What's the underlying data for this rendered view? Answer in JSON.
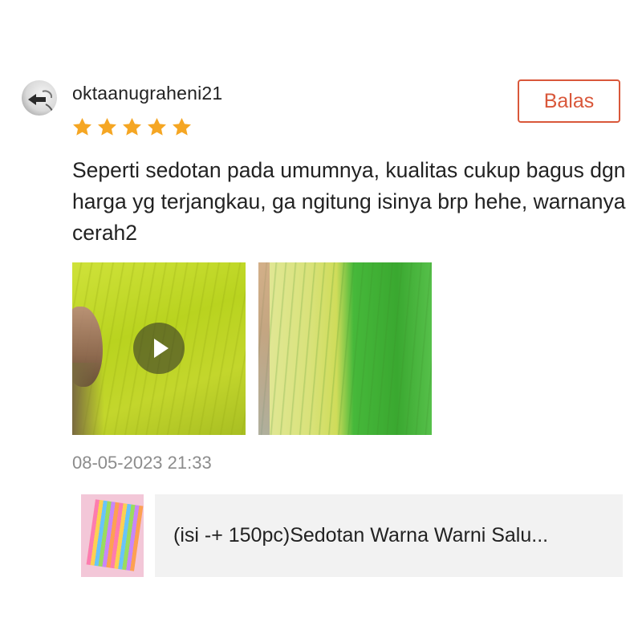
{
  "review": {
    "username": "oktaanugraheni21",
    "rating": 5,
    "rating_max": 5,
    "reply_label": "Balas",
    "text": "Seperti sedotan pada umumnya, kualitas cukup bagus dgn harga yg terjangkau, ga ngitung isinya brp hehe, warnanya cerah2",
    "timestamp": "08-05-2023 21:33",
    "media": [
      {
        "type": "video",
        "icon": "play-icon"
      },
      {
        "type": "image"
      }
    ]
  },
  "product": {
    "title": "(isi -+ 150pc)Sedotan Warna Warni Salu..."
  },
  "colors": {
    "accent": "#d9573a",
    "star": "#f5a623",
    "text": "#222222",
    "muted": "#8c8c8c",
    "card_bg": "#f2f2f2"
  },
  "icons": {
    "avatar": "avatar-icon",
    "star": "star-icon",
    "play": "play-icon"
  }
}
